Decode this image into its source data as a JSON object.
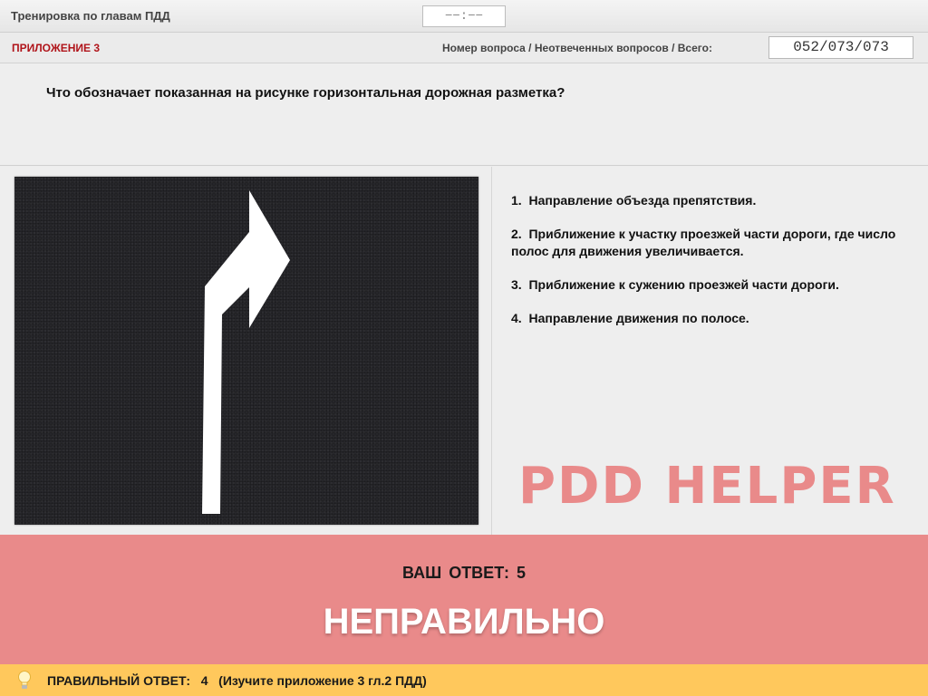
{
  "header": {
    "app_title": "Тренировка по главам ПДД",
    "timer": "−−:−−"
  },
  "info": {
    "appendix": "ПРИЛОЖЕНИЕ 3",
    "counter_label": "Номер вопроса / Неотвеченных вопросов / Всего:",
    "counter_value": "052/073/073"
  },
  "question": {
    "text": "Что обозначает показанная на рисунке горизонтальная дорожная разметка?"
  },
  "answers": [
    {
      "number": "1.",
      "text": "Направление объезда препятствия."
    },
    {
      "number": "2.",
      "text": "Приближение к участку проезжей части дороги, где число полос для движения увеличивается."
    },
    {
      "number": "3.",
      "text": "Приближение к сужению проезжей части дороги."
    },
    {
      "number": "4.",
      "text": "Направление движения по полосе."
    }
  ],
  "watermark": "PDD HELPER",
  "result": {
    "your_answer_label": "ВАШ ОТВЕТ:",
    "your_answer_value": "5",
    "verdict": "НЕПРАВИЛЬНО"
  },
  "hint": {
    "icon": "lightbulb-icon",
    "text": "ПРАВИЛЬНЫЙ ОТВЕТ:   4   (Изучите приложение 3 гл.2 ПДД)"
  },
  "colors": {
    "appendix": "#b0141a",
    "result_band": "#e98a8a",
    "hint_band": "#ffc85c",
    "watermark": "#e98a8a",
    "road": "#26262a"
  }
}
